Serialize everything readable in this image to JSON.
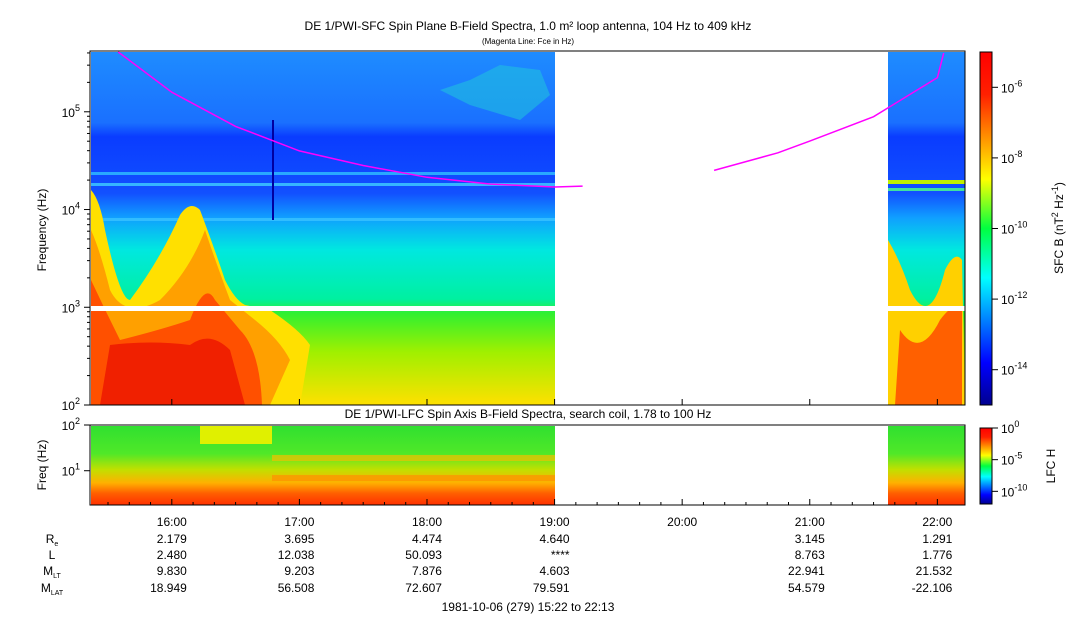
{
  "chart_data": [
    {
      "type": "heatmap",
      "title": "DE 1/PWI-SFC  Spin Plane B-Field Spectra, 1.0 m² loop antenna, 104 Hz to 409 kHz",
      "subtitle": "(Magenta Line: Fce in Hz)",
      "ylabel": "Frequency (Hz)",
      "yscale": "log",
      "ylim": [
        100,
        409000
      ],
      "yticks": [
        {
          "v": 2,
          "label": "10",
          "exp": "2"
        },
        {
          "v": 3,
          "label": "10",
          "exp": "3"
        },
        {
          "v": 4,
          "label": "10",
          "exp": "4"
        },
        {
          "v": 5,
          "label": "10",
          "exp": "5"
        }
      ],
      "colorbar": {
        "label": "SFC B (nT",
        "label_exp1": "2",
        "label_mid": " Hz",
        "label_exp2": "-1",
        "label_end": ")",
        "scale": "log",
        "range_exp": [
          -15,
          -5
        ],
        "ticks": [
          {
            "v": -6,
            "label": "10",
            "exp": "-6"
          },
          {
            "v": -8,
            "label": "10",
            "exp": "-8"
          },
          {
            "v": -10,
            "label": "10",
            "exp": "-10"
          },
          {
            "v": -12,
            "label": "10",
            "exp": "-12"
          },
          {
            "v": -14,
            "label": "10",
            "exp": "-14"
          }
        ]
      },
      "data_gap_hours": [
        19.0,
        21.62
      ],
      "fce_line": {
        "color": "#ff00ff",
        "segments": [
          [
            [
              15.58,
              5.65
            ],
            [
              16.0,
              5.2
            ],
            [
              16.5,
              4.85
            ],
            [
              17.0,
              4.6
            ],
            [
              17.5,
              4.45
            ],
            [
              18.0,
              4.33
            ],
            [
              18.5,
              4.26
            ],
            [
              19.0,
              4.23
            ],
            [
              19.22,
              4.24
            ]
          ],
          [
            [
              20.25,
              4.4
            ],
            [
              20.75,
              4.58
            ],
            [
              21.0,
              4.7
            ],
            [
              21.5,
              4.95
            ],
            [
              21.75,
              5.15
            ],
            [
              22.0,
              5.35
            ],
            [
              22.05,
              5.6
            ]
          ]
        ]
      }
    },
    {
      "type": "heatmap",
      "title": "DE 1/PWI-LFC  Spin Axis B-Field Spectra, search coil, 1.78 to 100 Hz",
      "ylabel": "Freq (Hz)",
      "yscale": "log",
      "ylim": [
        1.78,
        100
      ],
      "yticks": [
        {
          "v": 2,
          "label": "10",
          "exp": "2"
        },
        {
          "v": 1,
          "label": "10",
          "exp": "1"
        }
      ],
      "colorbar": {
        "label": "LFC H",
        "scale": "log",
        "range_exp": [
          -12,
          0
        ],
        "ticks": [
          {
            "v": 0,
            "label": "10",
            "exp": "0"
          },
          {
            "v": -5,
            "label": "10",
            "exp": "-5"
          },
          {
            "v": -10,
            "label": "10",
            "exp": "-10"
          }
        ]
      },
      "data_gap_hours": [
        19.0,
        21.62
      ]
    }
  ],
  "xaxis": {
    "start_hour": 15.3667,
    "end_hour": 22.2167,
    "ticks": [
      {
        "h": 16,
        "label": "16:00"
      },
      {
        "h": 17,
        "label": "17:00"
      },
      {
        "h": 18,
        "label": "18:00"
      },
      {
        "h": 19,
        "label": "19:00"
      },
      {
        "h": 20,
        "label": "20:00"
      },
      {
        "h": 21,
        "label": "21:00"
      },
      {
        "h": 22,
        "label": "22:00"
      }
    ]
  },
  "ephemeris": [
    {
      "label": "R",
      "sub": "e",
      "values": [
        "2.179",
        "3.695",
        "4.474",
        "4.640",
        "",
        "3.145",
        "1.291"
      ]
    },
    {
      "label": "L",
      "sub": "",
      "values": [
        "2.480",
        "12.038",
        "50.093",
        "****",
        "",
        "8.763",
        "1.776"
      ]
    },
    {
      "label": "M",
      "sub": "LT",
      "values": [
        "9.830",
        "9.203",
        "7.876",
        "4.603",
        "",
        "22.941",
        "21.532"
      ]
    },
    {
      "label": "M",
      "sub": "LAT",
      "values": [
        "18.949",
        "56.508",
        "72.607",
        "79.591",
        "",
        "54.579",
        "-22.106"
      ]
    }
  ],
  "footer": "1981-10-06 (279) 15:22 to 22:13"
}
